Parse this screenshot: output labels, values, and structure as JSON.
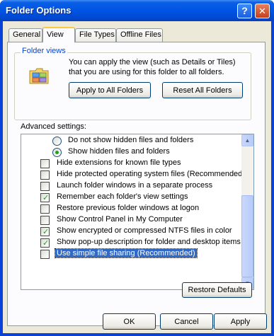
{
  "window": {
    "title": "Folder Options",
    "help_glyph": "?",
    "close_glyph": "✕"
  },
  "tabs": [
    {
      "label": "General"
    },
    {
      "label": "View"
    },
    {
      "label": "File Types"
    },
    {
      "label": "Offline Files"
    }
  ],
  "folder_views": {
    "legend": "Folder views",
    "description": "You can apply the view (such as Details or Tiles) that you are using for this folder to all folders.",
    "apply_button": "Apply to All Folders",
    "reset_button": "Reset All Folders"
  },
  "advanced": {
    "label": "Advanced settings:",
    "items": [
      {
        "type": "radio",
        "label": "Do not show hidden files and folders",
        "checked": false
      },
      {
        "type": "radio",
        "label": "Show hidden files and folders",
        "checked": true
      },
      {
        "type": "checkbox",
        "label": "Hide extensions for known file types",
        "checked": false
      },
      {
        "type": "checkbox",
        "label": "Hide protected operating system files (Recommended)",
        "checked": false
      },
      {
        "type": "checkbox",
        "label": "Launch folder windows in a separate process",
        "checked": false
      },
      {
        "type": "checkbox",
        "label": "Remember each folder's view settings",
        "checked": true
      },
      {
        "type": "checkbox",
        "label": "Restore previous folder windows at logon",
        "checked": false
      },
      {
        "type": "checkbox",
        "label": "Show Control Panel in My Computer",
        "checked": false
      },
      {
        "type": "checkbox",
        "label": "Show encrypted or compressed NTFS files in color",
        "checked": true
      },
      {
        "type": "checkbox",
        "label": "Show pop-up description for folder and desktop items",
        "checked": true
      },
      {
        "type": "checkbox",
        "label": "Use simple file sharing (Recommended)",
        "checked": false,
        "selected": true
      }
    ],
    "restore_button": "Restore Defaults"
  },
  "footer": {
    "ok": "OK",
    "cancel": "Cancel",
    "apply": "Apply"
  },
  "colors": {
    "title_bar": "#0054e3",
    "selection": "#316ac5",
    "check": "#21a121"
  }
}
